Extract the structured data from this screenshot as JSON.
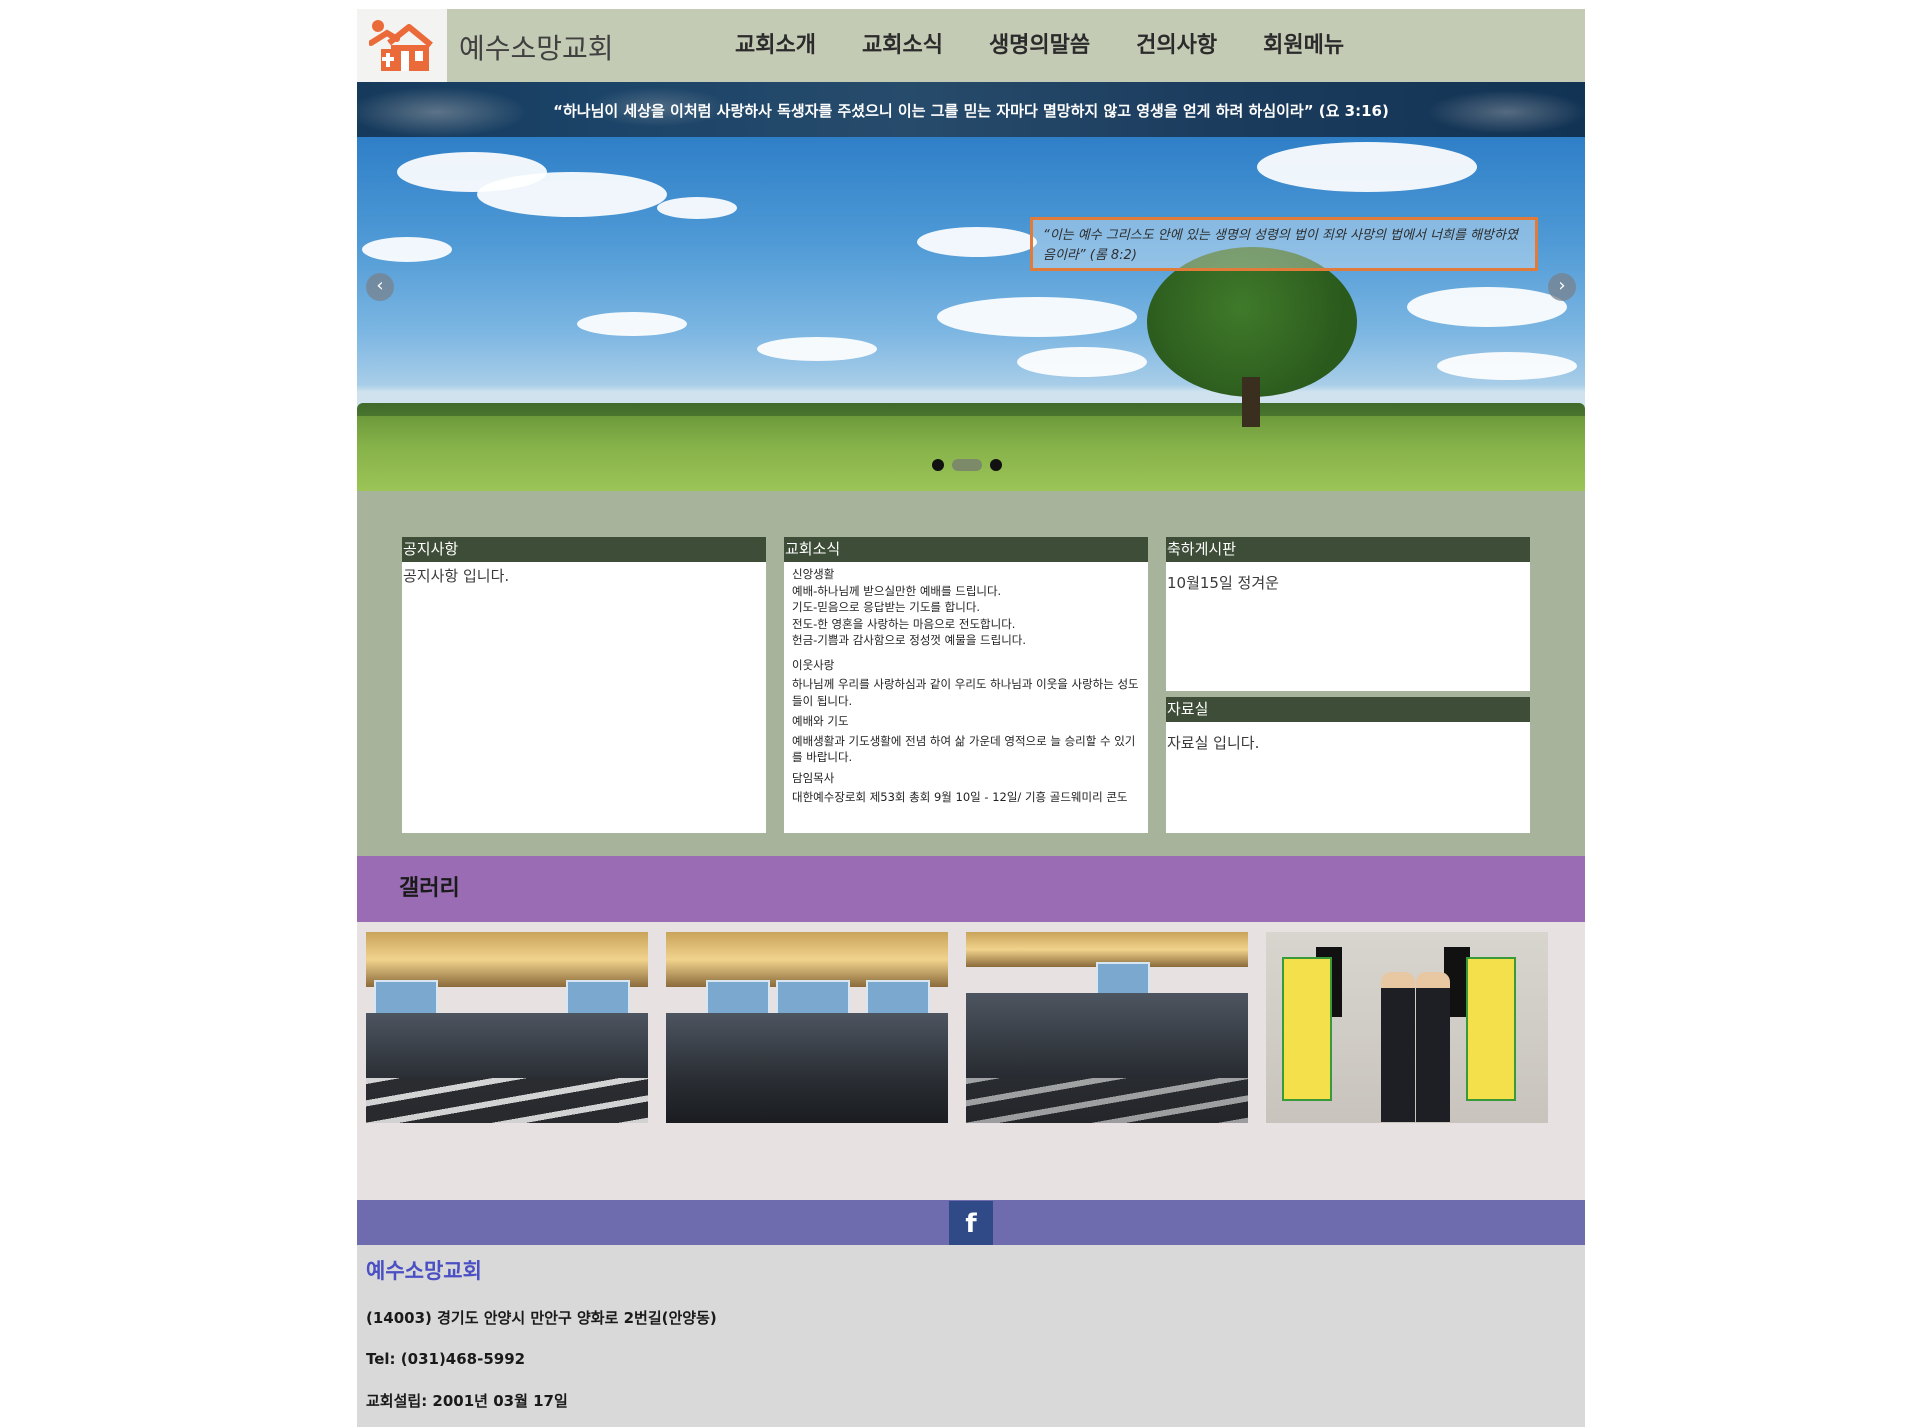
{
  "header": {
    "site_name": "예수소망교회",
    "nav": [
      "교회소개",
      "교회소식",
      "생명의말씀",
      "건의사항",
      "회원메뉴"
    ]
  },
  "verse_banner": {
    "text": "“하나님이 세상을 이처럼 사랑하사 독생자를 주셨으니 이는 그를 믿는 자마다 멸망하지 않고 영생을 얻게 하려 하심이라” (요 3:16)"
  },
  "hero": {
    "quote": "“이는 예수 그리스도 안에 있는 생명의 성령의 법이 죄와 사망의 법에서 너희를 해방하였음이라” (롬 8:2)",
    "prev_icon": "chevron-left-icon",
    "next_icon": "chevron-right-icon",
    "slides": 3,
    "active_slide": 2
  },
  "boards": {
    "notice": {
      "title": "공지사항",
      "body": "공지사항 입니다."
    },
    "news": {
      "title": "교회소식",
      "sections": [
        {
          "heading": "신앙생활",
          "lines": [
            "예배-하나님께 받으실만한 예배를 드립니다.",
            "기도-믿음으로 응답받는 기도를 합니다.",
            "전도-한 영혼을 사랑하는 마음으로 전도합니다.",
            "헌금-기쁨과 감사함으로 정성껏 예물을 드립니다."
          ]
        },
        {
          "heading": "이웃사랑",
          "lines": [
            "하나님께 우리를 사랑하심과 같이 우리도 하나님과 이웃을 사랑하는 성도들이 됩니다."
          ]
        },
        {
          "heading": "예배와 기도",
          "lines": [
            "예배생활과 기도생활에 전념 하여 삶 가운데 영적으로 늘 승리할 수 있기를 바랍니다."
          ]
        },
        {
          "heading": "담임목사",
          "lines": [
            "대한예수장로회 제53회 총회 9월 10일 - 12일/ 기흥 골드웨미리 콘도"
          ]
        }
      ]
    },
    "celebration": {
      "title": "축하게시판",
      "body": "10월15일 정겨운"
    },
    "archive": {
      "title": "자료실",
      "body": "자료실 입니다."
    }
  },
  "gallery": {
    "title": "갤러리",
    "photos": [
      "gallery-photo-1",
      "gallery-photo-2",
      "gallery-photo-3",
      "gallery-photo-4"
    ]
  },
  "footer": {
    "social_icon": "facebook-icon",
    "social_glyph": "f",
    "church_name": "예수소망교회",
    "address": "(14003) 경기도 안양시 만안구 양화로 2번길(안양동)",
    "tel": "Tel: (031)468-5992",
    "founded": "교회설립: 2001년 03월 17일"
  },
  "colors": {
    "header_bg": "#c3cbb5",
    "board_area_bg": "#a8b39b",
    "board_head_bg": "#3e4d37",
    "gallery_title_bg": "#996cb3",
    "gallery_bg": "#e7e1e1",
    "social_bar_bg": "#6e6baf",
    "footer_bg": "#d9d9d9",
    "footer_name": "#4a4fc4",
    "logo_orange": "#ea6a3a"
  }
}
